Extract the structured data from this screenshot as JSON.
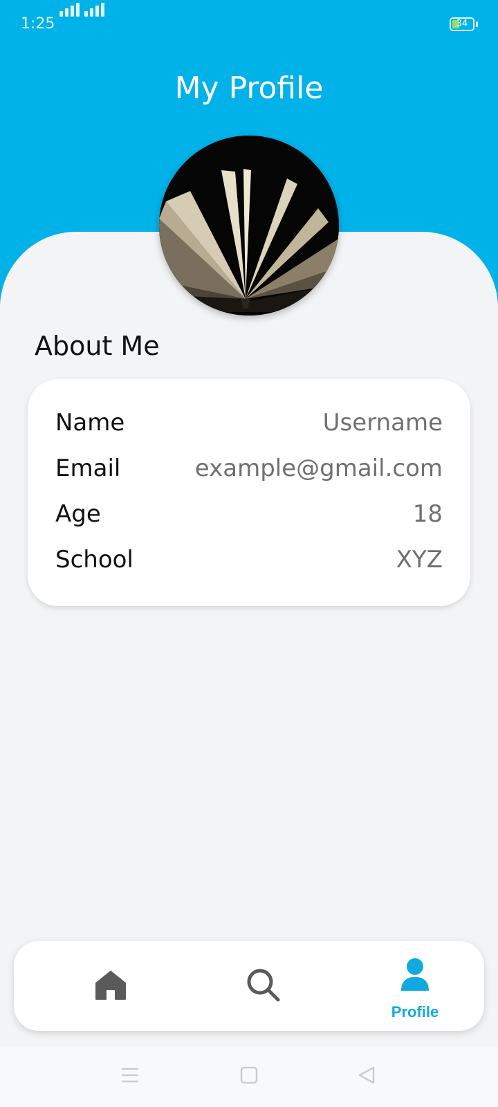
{
  "status_bar": {
    "time": "1:25",
    "battery_level": "34"
  },
  "header": {
    "title": "My Profile"
  },
  "about": {
    "section_title": "About Me",
    "fields": [
      {
        "label": "Name",
        "value": "Username"
      },
      {
        "label": "Email",
        "value": "example@gmail.com"
      },
      {
        "label": "Age",
        "value": "18"
      },
      {
        "label": "School",
        "value": "XYZ"
      }
    ]
  },
  "bottom_nav": {
    "items": [
      {
        "icon": "home-icon",
        "label": "",
        "active": false
      },
      {
        "icon": "search-icon",
        "label": "",
        "active": false
      },
      {
        "icon": "profile-icon",
        "label": "Profile",
        "active": true
      }
    ]
  },
  "system_nav": {
    "buttons": [
      "menu-icon",
      "home-square-icon",
      "back-icon"
    ]
  },
  "colors": {
    "accent": "#00b2e8",
    "active_nav": "#12a9e0",
    "inactive_nav": "#5a5a5a",
    "background": "#f3f4f6"
  }
}
